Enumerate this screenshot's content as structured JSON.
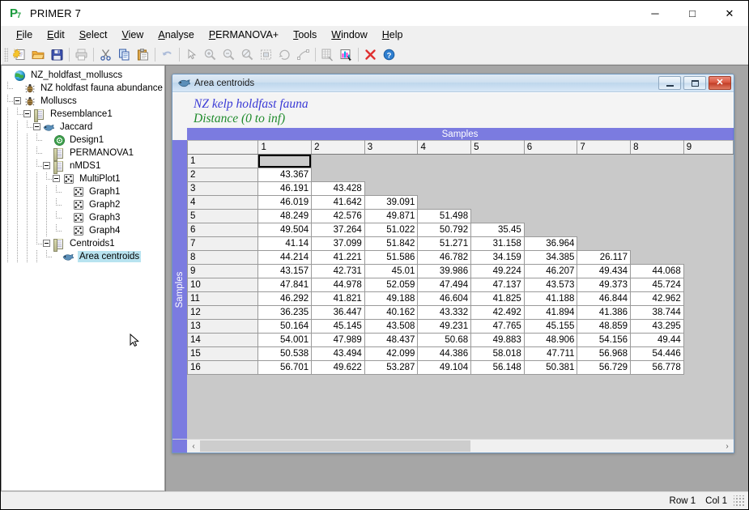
{
  "app": {
    "title": "PRIMER 7",
    "icon": "primer-logo-icon",
    "window_controls": {
      "minimize": "─",
      "maximize": "□",
      "close": "✕"
    }
  },
  "menu": {
    "items": [
      {
        "label": "File",
        "accel": "F"
      },
      {
        "label": "Edit",
        "accel": "E"
      },
      {
        "label": "Select",
        "accel": "S"
      },
      {
        "label": "View",
        "accel": "V"
      },
      {
        "label": "Analyse",
        "accel": "A"
      },
      {
        "label": "PERMANOVA+",
        "accel": "P"
      },
      {
        "label": "Tools",
        "accel": "T"
      },
      {
        "label": "Window",
        "accel": "W"
      },
      {
        "label": "Help",
        "accel": "H"
      }
    ]
  },
  "toolbar": {
    "buttons": [
      {
        "name": "new-icon",
        "enabled": true
      },
      {
        "name": "open-folder-icon",
        "enabled": true
      },
      {
        "name": "save-disk-icon",
        "enabled": true
      },
      {
        "name": "print-icon",
        "enabled": false
      },
      {
        "name": "cut-scissors-icon",
        "enabled": true
      },
      {
        "name": "copy-icon",
        "enabled": true
      },
      {
        "name": "paste-icon",
        "enabled": true
      },
      {
        "name": "undo-icon",
        "enabled": false
      },
      {
        "name": "pointer-arrow-icon",
        "enabled": false
      },
      {
        "name": "zoom-in-icon",
        "enabled": false
      },
      {
        "name": "zoom-out-icon",
        "enabled": false
      },
      {
        "name": "zoom-reset-icon",
        "enabled": false
      },
      {
        "name": "select-region-icon",
        "enabled": false
      },
      {
        "name": "rotate-icon",
        "enabled": false
      },
      {
        "name": "reshape-icon",
        "enabled": false
      },
      {
        "name": "data-matrix-icon",
        "enabled": false
      },
      {
        "name": "bar-chart-icon",
        "enabled": true
      },
      {
        "name": "close-x-icon",
        "enabled": true
      },
      {
        "name": "help-question-icon",
        "enabled": true
      }
    ]
  },
  "explorer": {
    "nodes": [
      {
        "label": "NZ_holdfast_molluscs",
        "icon": "globe-icon",
        "indent": 0,
        "expander": false,
        "selected": false
      },
      {
        "label": "NZ holdfast fauna abundance",
        "icon": "bug-icon",
        "indent": 1,
        "expander": false,
        "selected": false
      },
      {
        "label": "Molluscs",
        "icon": "bug-icon",
        "indent": 1,
        "expander": true,
        "selected": false
      },
      {
        "label": "Resemblance1",
        "icon": "sheet-icon",
        "indent": 2,
        "expander": true,
        "selected": false
      },
      {
        "label": "Jaccard",
        "icon": "fish-icon",
        "indent": 3,
        "expander": true,
        "selected": false
      },
      {
        "label": "Design1",
        "icon": "design-icon",
        "indent": 4,
        "expander": false,
        "selected": false
      },
      {
        "label": "PERMANOVA1",
        "icon": "sheet-icon",
        "indent": 4,
        "expander": false,
        "selected": false
      },
      {
        "label": "nMDS1",
        "icon": "sheet-icon",
        "indent": 4,
        "expander": true,
        "selected": false
      },
      {
        "label": "MultiPlot1",
        "icon": "graph-icon",
        "indent": 5,
        "expander": true,
        "selected": false
      },
      {
        "label": "Graph1",
        "icon": "graph-icon",
        "indent": 6,
        "expander": false,
        "selected": false
      },
      {
        "label": "Graph2",
        "icon": "graph-icon",
        "indent": 6,
        "expander": false,
        "selected": false
      },
      {
        "label": "Graph3",
        "icon": "graph-icon",
        "indent": 6,
        "expander": false,
        "selected": false
      },
      {
        "label": "Graph4",
        "icon": "graph-icon",
        "indent": 6,
        "expander": false,
        "selected": false
      },
      {
        "label": "Centroids1",
        "icon": "sheet-icon",
        "indent": 4,
        "expander": true,
        "selected": false
      },
      {
        "label": "Area centroids",
        "icon": "fish-icon",
        "indent": 5,
        "expander": false,
        "selected": true
      }
    ]
  },
  "child_window": {
    "title": "Area centroids",
    "icon": "fish-icon",
    "controls": {
      "minimize": "minimize",
      "maximize": "maximize",
      "close": "✕"
    },
    "sheet_title_1": "NZ kelp holdfast fauna",
    "sheet_title_2": "Distance (0 to inf)",
    "band_top_label": "Samples",
    "band_left_label": "Samples",
    "scroll": {
      "left_arrow": "‹",
      "right_arrow": "›"
    }
  },
  "matrix": {
    "col_headers": [
      "1",
      "2",
      "3",
      "4",
      "5",
      "6",
      "7",
      "8",
      "9"
    ],
    "row_headers": [
      "1",
      "2",
      "3",
      "4",
      "5",
      "6",
      "7",
      "8",
      "9",
      "10",
      "11",
      "12",
      "13",
      "14",
      "15",
      "16"
    ],
    "selected_cell": {
      "row": 1,
      "col": 1
    },
    "rows": [
      [],
      [
        "43.367"
      ],
      [
        "46.191",
        "43.428"
      ],
      [
        "46.019",
        "41.642",
        "39.091"
      ],
      [
        "48.249",
        "42.576",
        "49.871",
        "51.498"
      ],
      [
        "49.504",
        "37.264",
        "51.022",
        "50.792",
        "35.45"
      ],
      [
        "41.14",
        "37.099",
        "51.842",
        "51.271",
        "31.158",
        "36.964"
      ],
      [
        "44.214",
        "41.221",
        "51.586",
        "46.782",
        "34.159",
        "34.385",
        "26.117"
      ],
      [
        "43.157",
        "42.731",
        "45.01",
        "39.986",
        "49.224",
        "46.207",
        "49.434",
        "44.068"
      ],
      [
        "47.841",
        "44.978",
        "52.059",
        "47.494",
        "47.137",
        "43.573",
        "49.373",
        "45.724"
      ],
      [
        "46.292",
        "41.821",
        "49.188",
        "46.604",
        "41.825",
        "41.188",
        "46.844",
        "42.962"
      ],
      [
        "36.235",
        "36.447",
        "40.162",
        "43.332",
        "42.492",
        "41.894",
        "41.386",
        "38.744"
      ],
      [
        "50.164",
        "45.145",
        "43.508",
        "49.231",
        "47.765",
        "45.155",
        "48.859",
        "43.295"
      ],
      [
        "54.001",
        "47.989",
        "48.437",
        "50.68",
        "49.883",
        "48.906",
        "54.156",
        "49.44"
      ],
      [
        "50.538",
        "43.494",
        "42.099",
        "44.386",
        "58.018",
        "47.711",
        "56.968",
        "54.446"
      ],
      [
        "56.701",
        "49.622",
        "53.287",
        "49.104",
        "56.148",
        "50.381",
        "56.729",
        "56.778"
      ]
    ]
  },
  "status_bar": {
    "row": "Row 1",
    "col": "Col 1"
  },
  "colors": {
    "band_purple": "#7b7be0",
    "title_blue": "#3a3ad6",
    "title_green": "#1f8b2c",
    "selection_cyan": "#b8e3f0",
    "mdi_gray": "#a6a6a6"
  }
}
